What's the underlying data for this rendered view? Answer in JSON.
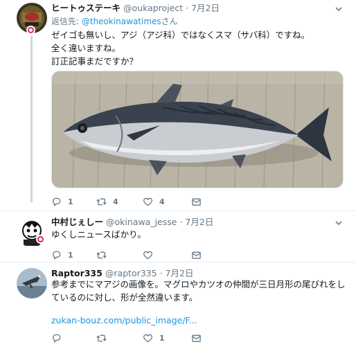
{
  "tweets": [
    {
      "name": "ヒートゥステーキ",
      "handle": "@oukaproject",
      "date": "7月2日",
      "reply_prefix": "返信先: ",
      "reply_handle": "@theokinawatimes",
      "reply_suffix": "さん",
      "lines": [
        "ゼイゴも無いし、アジ（アジ科）ではなくスマ（サバ科）ですね。",
        "全く違いますね。",
        "訂正記事まだですか？"
      ],
      "counts": {
        "replies": "1",
        "retweets": "4",
        "likes": "4"
      }
    },
    {
      "name": "中村じぇしー",
      "handle": "@okinawa_jesse",
      "date": "7月2日",
      "lines": [
        "ゆくしニュースばかり。"
      ],
      "counts": {
        "replies": "1",
        "retweets": "",
        "likes": ""
      }
    },
    {
      "name": "Raptor335",
      "handle": "@raptor335",
      "date": "7月2日",
      "lines": [
        "参考までにマアジの画像を。マグロやカツオの仲間が三日月形の尾びれをし",
        "ているのに対し、形が全然違います。"
      ],
      "link": "zukan-bouz.com/public_image/F...",
      "counts": {
        "replies": "",
        "retweets": "",
        "likes": "1"
      }
    }
  ],
  "separator": "·",
  "icons": {
    "more": "chevron-down-icon",
    "reply": "reply-icon",
    "retweet": "retweet-icon",
    "like": "heart-icon",
    "dm": "envelope-icon"
  },
  "colors": {
    "link": "#1b95e0",
    "secondary": "#657786",
    "thread": "#ccd6dd",
    "badge": "#e0245e"
  }
}
